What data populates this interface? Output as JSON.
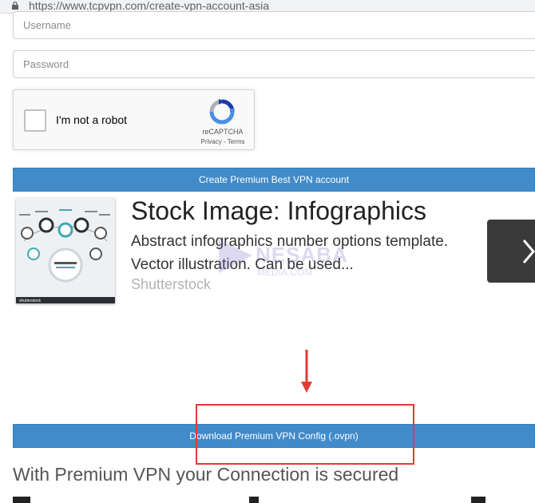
{
  "browser": {
    "url": "https://www.tcpvpn.com/create-vpn-account-asia"
  },
  "form": {
    "username_placeholder": "Username",
    "password_placeholder": "Password",
    "recaptcha": {
      "label": "I'm not a robot",
      "brand": "reCAPTCHA",
      "links": "Privacy - Terms"
    },
    "create_button_label": "Create Premium Best VPN account",
    "download_button_label": "Download Premium VPN Config (.ovpn)"
  },
  "ad": {
    "title": "Stock Image: Infographics",
    "description": "Abstract infographics number options template. Vector illustration. Can be used...",
    "source": "Shutterstock",
    "thumb_caption": "shutterstock"
  },
  "watermark": {
    "word": "NESABA",
    "sub": "MEDIA.COM"
  },
  "page": {
    "tagline": "With Premium VPN your Connection is secured"
  },
  "colors": {
    "button_blue": "#428bca",
    "annotation_red": "#e53935",
    "recaptcha_blue": "#4a90e2",
    "ad_arrow_bg": "#3a3a3a"
  }
}
